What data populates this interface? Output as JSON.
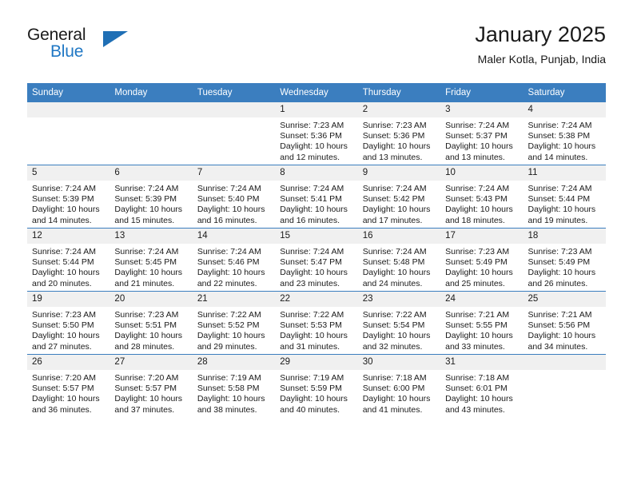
{
  "brand": {
    "name_primary": "General",
    "name_secondary": "Blue",
    "accent_color": "#1f77c4",
    "triangle_color": "#1f6fb5"
  },
  "header": {
    "title": "January 2025",
    "subtitle": "Maler Kotla, Punjab, India"
  },
  "theme": {
    "header_row_bg": "#3b7ebf",
    "daynum_bg": "#f0f0f0",
    "text_color": "#1a1a1a"
  },
  "weekday_headers": [
    "Sunday",
    "Monday",
    "Tuesday",
    "Wednesday",
    "Thursday",
    "Friday",
    "Saturday"
  ],
  "labels": {
    "sunrise_prefix": "Sunrise:",
    "sunset_prefix": "Sunset:",
    "daylight_prefix": "Daylight:"
  },
  "weeks": [
    [
      {
        "day": "",
        "blank": true
      },
      {
        "day": "",
        "blank": true
      },
      {
        "day": "",
        "blank": true
      },
      {
        "day": "1",
        "sunrise": "Sunrise: 7:23 AM",
        "sunset": "Sunset: 5:36 PM",
        "daylight": "Daylight: 10 hours and 12 minutes."
      },
      {
        "day": "2",
        "sunrise": "Sunrise: 7:23 AM",
        "sunset": "Sunset: 5:36 PM",
        "daylight": "Daylight: 10 hours and 13 minutes."
      },
      {
        "day": "3",
        "sunrise": "Sunrise: 7:24 AM",
        "sunset": "Sunset: 5:37 PM",
        "daylight": "Daylight: 10 hours and 13 minutes."
      },
      {
        "day": "4",
        "sunrise": "Sunrise: 7:24 AM",
        "sunset": "Sunset: 5:38 PM",
        "daylight": "Daylight: 10 hours and 14 minutes."
      }
    ],
    [
      {
        "day": "5",
        "sunrise": "Sunrise: 7:24 AM",
        "sunset": "Sunset: 5:39 PM",
        "daylight": "Daylight: 10 hours and 14 minutes."
      },
      {
        "day": "6",
        "sunrise": "Sunrise: 7:24 AM",
        "sunset": "Sunset: 5:39 PM",
        "daylight": "Daylight: 10 hours and 15 minutes."
      },
      {
        "day": "7",
        "sunrise": "Sunrise: 7:24 AM",
        "sunset": "Sunset: 5:40 PM",
        "daylight": "Daylight: 10 hours and 16 minutes."
      },
      {
        "day": "8",
        "sunrise": "Sunrise: 7:24 AM",
        "sunset": "Sunset: 5:41 PM",
        "daylight": "Daylight: 10 hours and 16 minutes."
      },
      {
        "day": "9",
        "sunrise": "Sunrise: 7:24 AM",
        "sunset": "Sunset: 5:42 PM",
        "daylight": "Daylight: 10 hours and 17 minutes."
      },
      {
        "day": "10",
        "sunrise": "Sunrise: 7:24 AM",
        "sunset": "Sunset: 5:43 PM",
        "daylight": "Daylight: 10 hours and 18 minutes."
      },
      {
        "day": "11",
        "sunrise": "Sunrise: 7:24 AM",
        "sunset": "Sunset: 5:44 PM",
        "daylight": "Daylight: 10 hours and 19 minutes."
      }
    ],
    [
      {
        "day": "12",
        "sunrise": "Sunrise: 7:24 AM",
        "sunset": "Sunset: 5:44 PM",
        "daylight": "Daylight: 10 hours and 20 minutes."
      },
      {
        "day": "13",
        "sunrise": "Sunrise: 7:24 AM",
        "sunset": "Sunset: 5:45 PM",
        "daylight": "Daylight: 10 hours and 21 minutes."
      },
      {
        "day": "14",
        "sunrise": "Sunrise: 7:24 AM",
        "sunset": "Sunset: 5:46 PM",
        "daylight": "Daylight: 10 hours and 22 minutes."
      },
      {
        "day": "15",
        "sunrise": "Sunrise: 7:24 AM",
        "sunset": "Sunset: 5:47 PM",
        "daylight": "Daylight: 10 hours and 23 minutes."
      },
      {
        "day": "16",
        "sunrise": "Sunrise: 7:24 AM",
        "sunset": "Sunset: 5:48 PM",
        "daylight": "Daylight: 10 hours and 24 minutes."
      },
      {
        "day": "17",
        "sunrise": "Sunrise: 7:23 AM",
        "sunset": "Sunset: 5:49 PM",
        "daylight": "Daylight: 10 hours and 25 minutes."
      },
      {
        "day": "18",
        "sunrise": "Sunrise: 7:23 AM",
        "sunset": "Sunset: 5:49 PM",
        "daylight": "Daylight: 10 hours and 26 minutes."
      }
    ],
    [
      {
        "day": "19",
        "sunrise": "Sunrise: 7:23 AM",
        "sunset": "Sunset: 5:50 PM",
        "daylight": "Daylight: 10 hours and 27 minutes."
      },
      {
        "day": "20",
        "sunrise": "Sunrise: 7:23 AM",
        "sunset": "Sunset: 5:51 PM",
        "daylight": "Daylight: 10 hours and 28 minutes."
      },
      {
        "day": "21",
        "sunrise": "Sunrise: 7:22 AM",
        "sunset": "Sunset: 5:52 PM",
        "daylight": "Daylight: 10 hours and 29 minutes."
      },
      {
        "day": "22",
        "sunrise": "Sunrise: 7:22 AM",
        "sunset": "Sunset: 5:53 PM",
        "daylight": "Daylight: 10 hours and 31 minutes."
      },
      {
        "day": "23",
        "sunrise": "Sunrise: 7:22 AM",
        "sunset": "Sunset: 5:54 PM",
        "daylight": "Daylight: 10 hours and 32 minutes."
      },
      {
        "day": "24",
        "sunrise": "Sunrise: 7:21 AM",
        "sunset": "Sunset: 5:55 PM",
        "daylight": "Daylight: 10 hours and 33 minutes."
      },
      {
        "day": "25",
        "sunrise": "Sunrise: 7:21 AM",
        "sunset": "Sunset: 5:56 PM",
        "daylight": "Daylight: 10 hours and 34 minutes."
      }
    ],
    [
      {
        "day": "26",
        "sunrise": "Sunrise: 7:20 AM",
        "sunset": "Sunset: 5:57 PM",
        "daylight": "Daylight: 10 hours and 36 minutes."
      },
      {
        "day": "27",
        "sunrise": "Sunrise: 7:20 AM",
        "sunset": "Sunset: 5:57 PM",
        "daylight": "Daylight: 10 hours and 37 minutes."
      },
      {
        "day": "28",
        "sunrise": "Sunrise: 7:19 AM",
        "sunset": "Sunset: 5:58 PM",
        "daylight": "Daylight: 10 hours and 38 minutes."
      },
      {
        "day": "29",
        "sunrise": "Sunrise: 7:19 AM",
        "sunset": "Sunset: 5:59 PM",
        "daylight": "Daylight: 10 hours and 40 minutes."
      },
      {
        "day": "30",
        "sunrise": "Sunrise: 7:18 AM",
        "sunset": "Sunset: 6:00 PM",
        "daylight": "Daylight: 10 hours and 41 minutes."
      },
      {
        "day": "31",
        "sunrise": "Sunrise: 7:18 AM",
        "sunset": "Sunset: 6:01 PM",
        "daylight": "Daylight: 10 hours and 43 minutes."
      },
      {
        "day": "",
        "blank": true
      }
    ]
  ]
}
